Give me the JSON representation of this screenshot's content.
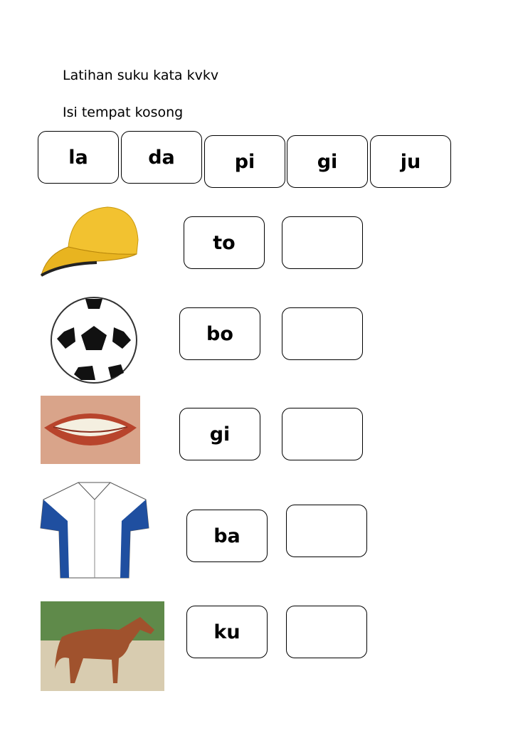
{
  "title": "Latihan suku kata kvkv",
  "instruction": "Isi tempat kosong",
  "syllable_bank": [
    "la",
    "da",
    "pi",
    "gi",
    "ju"
  ],
  "rows": [
    {
      "picture": "cap",
      "syllable": "to",
      "answer": ""
    },
    {
      "picture": "soccer-ball",
      "syllable": "bo",
      "answer": ""
    },
    {
      "picture": "teeth",
      "syllable": "gi",
      "answer": ""
    },
    {
      "picture": "shirt",
      "syllable": "ba",
      "answer": ""
    },
    {
      "picture": "horse",
      "syllable": "ku",
      "answer": ""
    }
  ],
  "colors": {
    "cap": "#f2c230",
    "lips": "#b8442c",
    "shirt_blue": "#1f4fa0",
    "horse": "#a0522d"
  }
}
